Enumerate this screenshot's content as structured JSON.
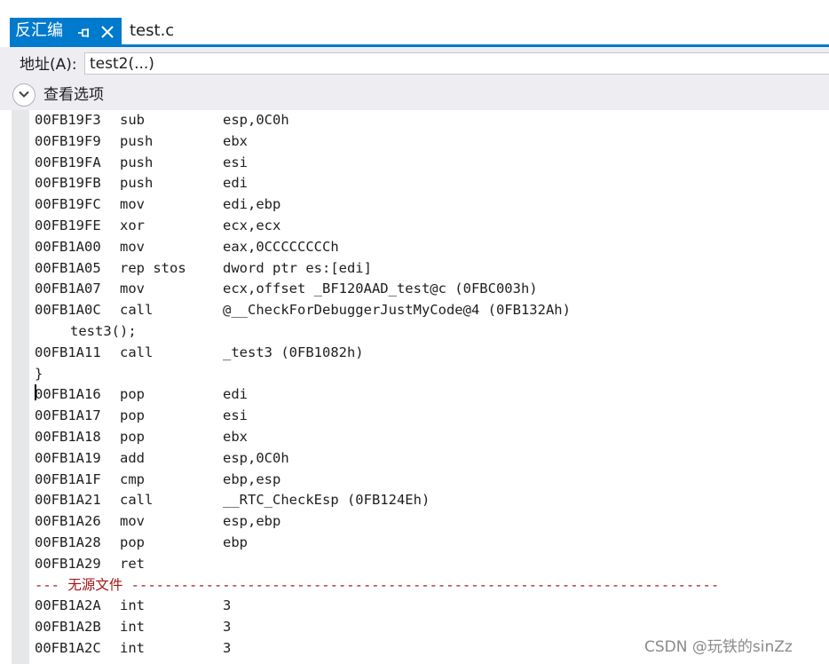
{
  "tabs": {
    "active_label": "反汇编",
    "pin_icon": "pin-icon",
    "close_icon": "close-icon",
    "inactive_label": "test.c"
  },
  "address": {
    "label": "地址(A):",
    "value": "test2(...)"
  },
  "view_options": {
    "label": "查看选项",
    "icon": "chevron-down-icon"
  },
  "disassembly": [
    {
      "addr": "00FB19F3",
      "op": "sub",
      "args": "esp,0C0h"
    },
    {
      "addr": "00FB19F9",
      "op": "push",
      "args": "ebx"
    },
    {
      "addr": "00FB19FA",
      "op": "push",
      "args": "esi"
    },
    {
      "addr": "00FB19FB",
      "op": "push",
      "args": "edi"
    },
    {
      "addr": "00FB19FC",
      "op": "mov",
      "args": "edi,ebp"
    },
    {
      "addr": "00FB19FE",
      "op": "xor",
      "args": "ecx,ecx"
    },
    {
      "addr": "00FB1A00",
      "op": "mov",
      "args": "eax,0CCCCCCCCh"
    },
    {
      "addr": "00FB1A05",
      "op": "rep stos",
      "args": "dword ptr es:[edi]"
    },
    {
      "addr": "00FB1A07",
      "op": "mov",
      "args": "ecx,offset _BF120AAD_test@c (0FBC003h)"
    },
    {
      "addr": "00FB1A0C",
      "op": "call",
      "args": "@__CheckForDebuggerJustMyCode@4 (0FB132Ah)"
    },
    {
      "source": "test3();"
    },
    {
      "addr": "00FB1A11",
      "op": "call",
      "args": "_test3 (0FB1082h)"
    },
    {
      "brace": "}"
    },
    {
      "addr": "00FB1A16",
      "op": "pop",
      "args": "edi",
      "caret": true
    },
    {
      "addr": "00FB1A17",
      "op": "pop",
      "args": "esi"
    },
    {
      "addr": "00FB1A18",
      "op": "pop",
      "args": "ebx"
    },
    {
      "addr": "00FB1A19",
      "op": "add",
      "args": "esp,0C0h"
    },
    {
      "addr": "00FB1A1F",
      "op": "cmp",
      "args": "ebp,esp"
    },
    {
      "addr": "00FB1A21",
      "op": "call",
      "args": "__RTC_CheckEsp (0FB124Eh)"
    },
    {
      "addr": "00FB1A26",
      "op": "mov",
      "args": "esp,ebp"
    },
    {
      "addr": "00FB1A28",
      "op": "pop",
      "args": "ebp"
    },
    {
      "addr": "00FB1A29",
      "op": "ret",
      "args": ""
    },
    {
      "separator": "--- 无源文件 -----------------------------------------------------------------------"
    },
    {
      "addr": "00FB1A2A",
      "op": "int",
      "args": "3"
    },
    {
      "addr": "00FB1A2B",
      "op": "int",
      "args": "3"
    },
    {
      "addr": "00FB1A2C",
      "op": "int",
      "args": "3"
    }
  ],
  "watermark": "CSDN @玩铁的sinZz"
}
